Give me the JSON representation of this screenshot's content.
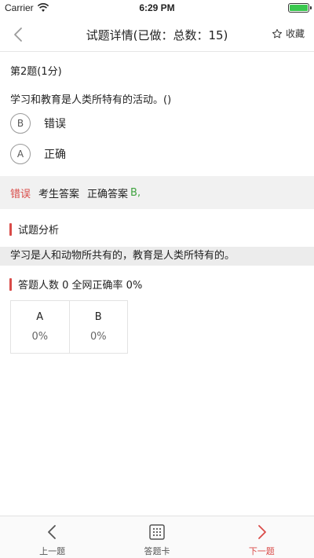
{
  "status_bar": {
    "carrier": "Carrier",
    "time": "6:29 PM"
  },
  "nav": {
    "title": "试题详情(已做：总数：15)",
    "favorite_label": "收藏"
  },
  "question": {
    "number": "第2题(1分)",
    "text": "学习和教育是人类所特有的活动。()",
    "options": [
      {
        "letter": "B",
        "text": "错误"
      },
      {
        "letter": "A",
        "text": "正确"
      }
    ]
  },
  "answer": {
    "result": "错误",
    "your_answer_label": "考生答案",
    "correct_label": "正确答案",
    "correct_value": "B,"
  },
  "analysis": {
    "heading": "试题分析",
    "text": "学习是人和动物所共有的，教育是人类所特有的。"
  },
  "stats": {
    "heading": "答题人数 0 全网正确率 0%",
    "columns": [
      {
        "option": "A",
        "percent": "0%"
      },
      {
        "option": "B",
        "percent": "0%"
      }
    ]
  },
  "bottom_bar": {
    "prev": "上一题",
    "card": "答题卡",
    "next": "下一题"
  },
  "colors": {
    "accent_red": "#d94b48",
    "correct_green": "#3fa33f",
    "band_gray": "#f1f1f1"
  }
}
